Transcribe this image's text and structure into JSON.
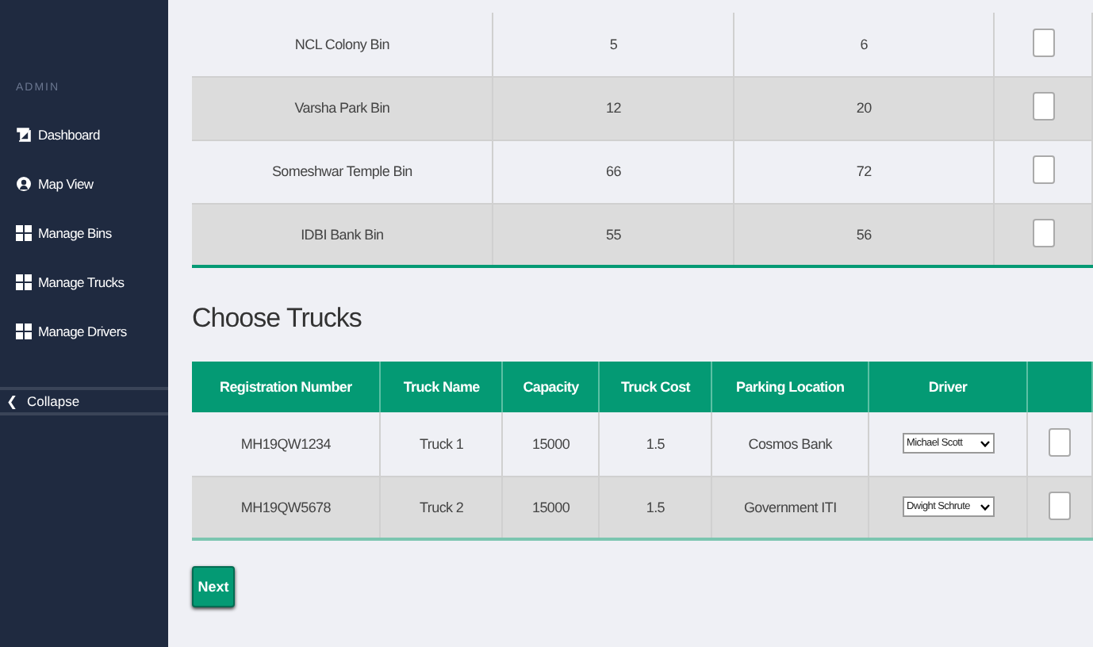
{
  "sidebar": {
    "section_label": "ADMIN",
    "items": [
      {
        "label": "Dashboard",
        "kind": "book"
      },
      {
        "label": "Map View",
        "kind": "user"
      },
      {
        "label": "Manage Bins",
        "kind": "grid"
      },
      {
        "label": "Manage Trucks",
        "kind": "grid"
      },
      {
        "label": "Manage Drivers",
        "kind": "grid"
      }
    ],
    "collapse": {
      "icon": "❮",
      "label": "Collapse"
    }
  },
  "bins_table": {
    "rows": [
      {
        "cells": [
          "NCL Colony Bin",
          "5",
          "6"
        ],
        "checked": false
      },
      {
        "cells": [
          "Varsha Park Bin",
          "12",
          "20"
        ],
        "checked": false
      },
      {
        "cells": [
          "Someshwar Temple Bin",
          "66",
          "72"
        ],
        "checked": false
      },
      {
        "cells": [
          "IDBI Bank Bin",
          "55",
          "56"
        ],
        "checked": false
      }
    ]
  },
  "trucks_section": {
    "title": "Choose Trucks",
    "columns": [
      "Registration Number",
      "Truck Name",
      "Capacity",
      "Truck Cost",
      "Parking Location",
      "Driver"
    ],
    "rows": [
      {
        "cells": [
          "MH19QW1234",
          "Truck 1",
          "15000",
          "1.5",
          "Cosmos Bank"
        ],
        "driver": "Michael Scott",
        "checked": false
      },
      {
        "cells": [
          "MH19QW5678",
          "Truck 2",
          "15000",
          "1.5",
          "Government ITI"
        ],
        "driver": "Dwight Schrute",
        "checked": false
      }
    ],
    "next_button": "Next"
  }
}
